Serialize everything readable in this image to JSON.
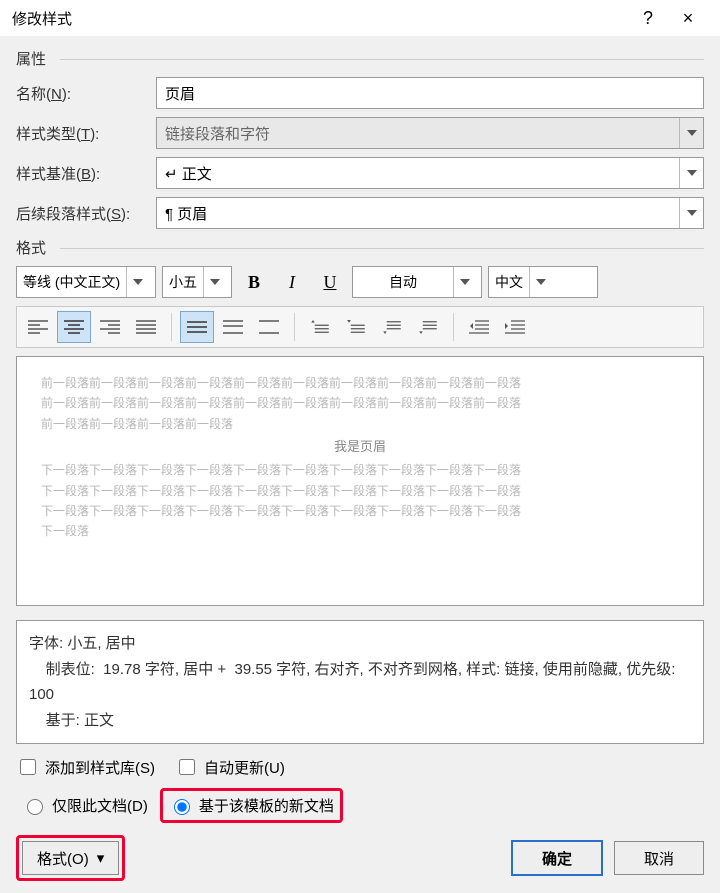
{
  "titlebar": {
    "title": "修改样式",
    "help": "?",
    "close": "×"
  },
  "sections": {
    "properties": "属性",
    "format": "格式"
  },
  "labels": {
    "name": "名称",
    "name_k": "N",
    "styletype": "样式类型",
    "styletype_k": "T",
    "basedon": "样式基准",
    "basedon_k": "B",
    "followpara": "后续段落样式",
    "followpara_k": "S"
  },
  "fields": {
    "name_value": "页眉",
    "styletype_value": "链接段落和字符",
    "basedon_value": "↵ 正文",
    "followpara_value": "¶ 页眉"
  },
  "format_toolbar": {
    "font_name": "等线 (中文正文)",
    "font_size": "小五",
    "bold": "B",
    "italic": "I",
    "underline": "U",
    "color": "自动",
    "lang": "中文"
  },
  "preview": {
    "line1": "前一段落前一段落前一段落前一段落前一段落前一段落前一段落前一段落前一段落前一段落",
    "line2": "前一段落前一段落前一段落前一段落前一段落前一段落前一段落前一段落前一段落前一段落",
    "line3": "前一段落前一段落前一段落前一段落",
    "center": "我是页眉",
    "line4": "下一段落下一段落下一段落下一段落下一段落下一段落下一段落下一段落下一段落下一段落",
    "line5": "下一段落下一段落下一段落下一段落下一段落下一段落下一段落下一段落下一段落下一段落",
    "line6": "下一段落下一段落下一段落下一段落下一段落下一段落下一段落下一段落下一段落下一段落",
    "line7": "下一段落"
  },
  "description": {
    "l1": "字体: 小五, 居中",
    "l2": "    制表位:  19.78 字符, 居中 +  39.55 字符, 右对齐, 不对齐到网格, 样式: 链接, 使用前隐藏, 优先级: 100",
    "l3": "    基于: 正文"
  },
  "options": {
    "add_gallery": "添加到样式库",
    "add_gallery_k": "S",
    "auto_update": "自动更新",
    "auto_update_k": "U",
    "only_doc": "仅限此文档",
    "only_doc_k": "D",
    "template_docs": "基于该模板的新文档"
  },
  "footer": {
    "format_btn": "格式",
    "format_k": "O",
    "ok": "确定",
    "cancel": "取消"
  }
}
